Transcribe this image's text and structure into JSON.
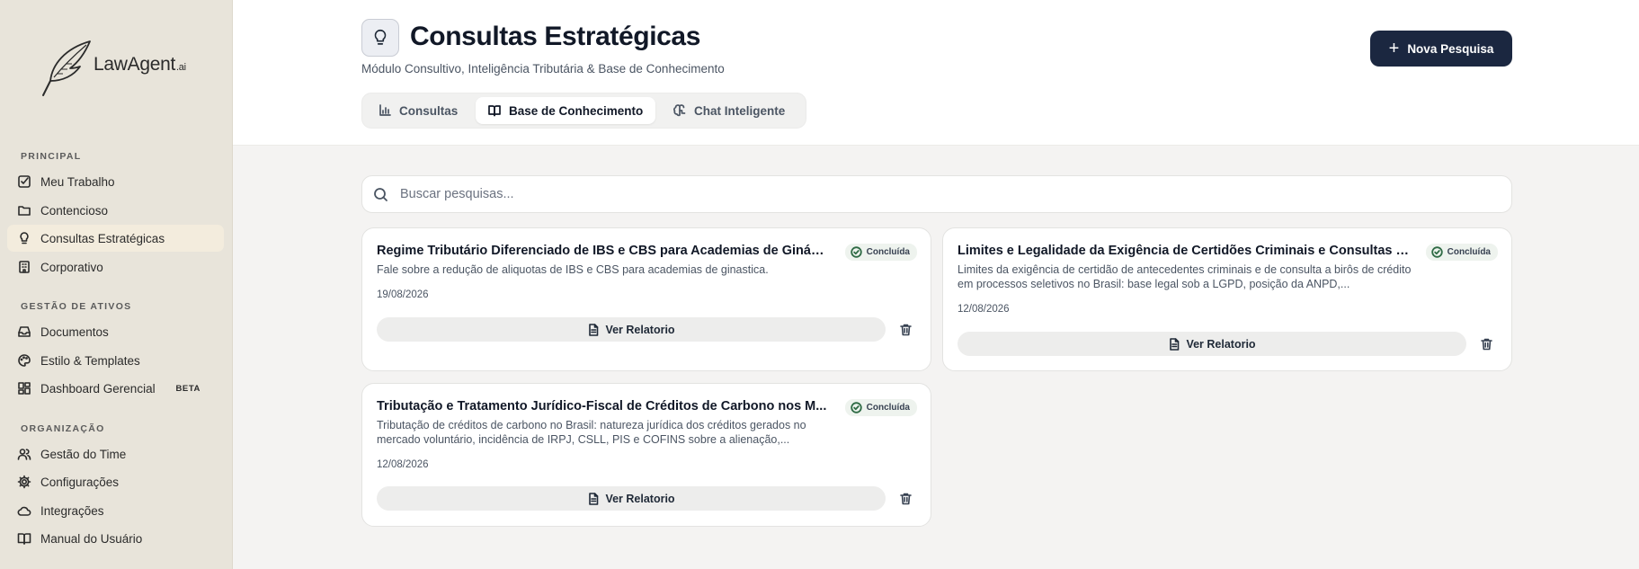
{
  "brand": {
    "name": "LawAgent",
    "suffix": ".ai"
  },
  "sidebar": {
    "sections": [
      {
        "label": "PRINCIPAL",
        "items": [
          {
            "label": "Meu Trabalho",
            "icon": "checkbox-icon"
          },
          {
            "label": "Contencioso",
            "icon": "folder-icon"
          },
          {
            "label": "Consultas Estratégicas",
            "icon": "lightbulb-icon",
            "active": true
          },
          {
            "label": "Corporativo",
            "icon": "building-icon"
          }
        ]
      },
      {
        "label": "GESTÃO DE ATIVOS",
        "items": [
          {
            "label": "Documentos",
            "icon": "inbox-icon"
          },
          {
            "label": "Estilo & Templates",
            "icon": "palette-icon"
          },
          {
            "label": "Dashboard Gerencial",
            "icon": "dashboard-icon",
            "badge": "BETA"
          }
        ]
      },
      {
        "label": "ORGANIZAÇÃO",
        "items": [
          {
            "label": "Gestão do Time",
            "icon": "users-icon"
          },
          {
            "label": "Configurações",
            "icon": "gear-icon"
          },
          {
            "label": "Integrações",
            "icon": "cloud-icon"
          },
          {
            "label": "Manual do Usuário",
            "icon": "book-icon"
          }
        ]
      }
    ]
  },
  "header": {
    "title": "Consultas Estratégicas",
    "subtitle": "Módulo Consultivo, Inteligência Tributária & Base de Conhecimento",
    "new_button": "Nova Pesquisa",
    "tabs": [
      {
        "label": "Consultas",
        "icon": "bar-chart-icon"
      },
      {
        "label": "Base de Conhecimento",
        "icon": "open-book-icon",
        "active": true
      },
      {
        "label": "Chat Inteligente",
        "icon": "brain-icon"
      }
    ]
  },
  "search": {
    "placeholder": "Buscar pesquisas..."
  },
  "cards": [
    {
      "title": "Regime Tributário Diferenciado de IBS e CBS para Academias de Ginásti...",
      "status": "Concluída",
      "description": "Fale sobre a redução de aliquotas de IBS e CBS para academias de ginastica.",
      "date": "19/08/2026",
      "action": "Ver Relatorio"
    },
    {
      "title": "Limites e Legalidade da Exigência de Certidões Criminais e Consultas a ...",
      "status": "Concluída",
      "description": "Limites da exigência de certidão de antecedentes criminais e de consulta a birôs de crédito em processos seletivos no Brasil: base legal sob a LGPD, posição da ANPD,...",
      "date": "12/08/2026",
      "action": "Ver Relatorio"
    },
    {
      "title": "Tributação e Tratamento Jurídico-Fiscal de Créditos de Carbono nos M...",
      "status": "Concluída",
      "description": "Tributação de créditos de carbono no Brasil: natureza jurídica dos créditos gerados no mercado voluntário, incidência de IRPJ, CSLL, PIS e COFINS sobre a alienação,...",
      "date": "12/08/2026",
      "action": "Ver Relatorio"
    }
  ]
}
